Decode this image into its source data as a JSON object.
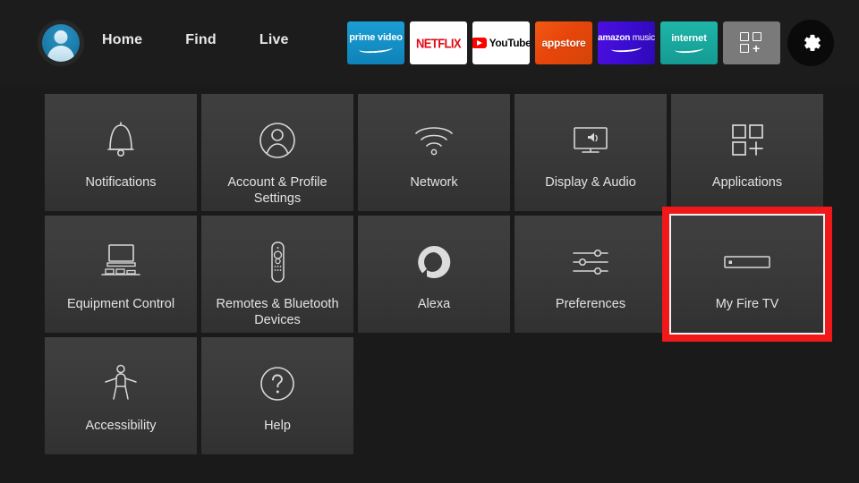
{
  "colors": {
    "background": "#1a1a1a",
    "nav_background": "#1c1c1c",
    "tile_top": "#3f3f3f",
    "tile_bottom": "#313131",
    "selection_red": "#f01818",
    "selection_inner": "#f2f2f2",
    "label_text": "#e3e3e3",
    "netflix_red": "#e50914",
    "youtube_red": "#ff0000",
    "prime_blue": "#1a9ed4",
    "appstore_orange": "#e8450a",
    "amazon_music_purple": "#3a0cd0",
    "internet_teal": "#149b94"
  },
  "topnav": {
    "avatar": {
      "icon": "user-avatar-icon"
    },
    "links": [
      {
        "label": "Home",
        "name": "nav-link-home"
      },
      {
        "label": "Find",
        "name": "nav-link-find"
      },
      {
        "label": "Live",
        "name": "nav-link-live"
      }
    ],
    "apps": [
      {
        "name": "app-tile-prime-video",
        "label": "prime video",
        "icon": "prime-video-icon"
      },
      {
        "name": "app-tile-netflix",
        "label": "NETFLIX",
        "icon": "netflix-icon"
      },
      {
        "name": "app-tile-youtube",
        "label": "YouTube",
        "icon": "youtube-icon"
      },
      {
        "name": "app-tile-appstore",
        "label": "appstore",
        "icon": "appstore-icon"
      },
      {
        "name": "app-tile-amazon-music",
        "label": "amazon music",
        "icon": "amazon-music-icon"
      },
      {
        "name": "app-tile-internet",
        "label": "internet",
        "icon": "internet-icon"
      },
      {
        "name": "app-tile-app-grid",
        "label": "",
        "icon": "app-grid-plus-icon"
      }
    ],
    "app_text": {
      "prime_line1": "prime video",
      "netflix": "NETFLIX",
      "youtube": "YouTube",
      "appstore": "appstore",
      "amazon_bold": "amazon",
      "amazon_light": " music",
      "internet": "internet"
    },
    "settings_button": {
      "name": "settings-gear-button",
      "icon": "gear-icon"
    }
  },
  "grid": {
    "tiles": [
      {
        "label": "Notifications",
        "icon": "bell-icon",
        "name": "tile-notifications",
        "selected": false
      },
      {
        "label": "Account & Profile Settings",
        "icon": "user-circle-icon",
        "name": "tile-account-profile-settings",
        "selected": false
      },
      {
        "label": "Network",
        "icon": "wifi-icon",
        "name": "tile-network",
        "selected": false
      },
      {
        "label": "Display & Audio",
        "icon": "tv-speaker-icon",
        "name": "tile-display-audio",
        "selected": false
      },
      {
        "label": "Applications",
        "icon": "app-grid-plus-icon",
        "name": "tile-applications",
        "selected": false
      },
      {
        "label": "Equipment Control",
        "icon": "tv-stand-icon",
        "name": "tile-equipment-control",
        "selected": false
      },
      {
        "label": "Remotes & Bluetooth Devices",
        "icon": "remote-icon",
        "name": "tile-remotes-bluetooth-devices",
        "selected": false
      },
      {
        "label": "Alexa",
        "icon": "alexa-ring-icon",
        "name": "tile-alexa",
        "selected": false
      },
      {
        "label": "Preferences",
        "icon": "sliders-icon",
        "name": "tile-preferences",
        "selected": false
      },
      {
        "label": "My Fire TV",
        "icon": "set-top-box-icon",
        "name": "tile-my-fire-tv",
        "selected": true
      },
      {
        "label": "Accessibility",
        "icon": "accessibility-icon",
        "name": "tile-accessibility",
        "selected": false
      },
      {
        "label": "Help",
        "icon": "question-circle-icon",
        "name": "tile-help",
        "selected": false
      }
    ]
  }
}
